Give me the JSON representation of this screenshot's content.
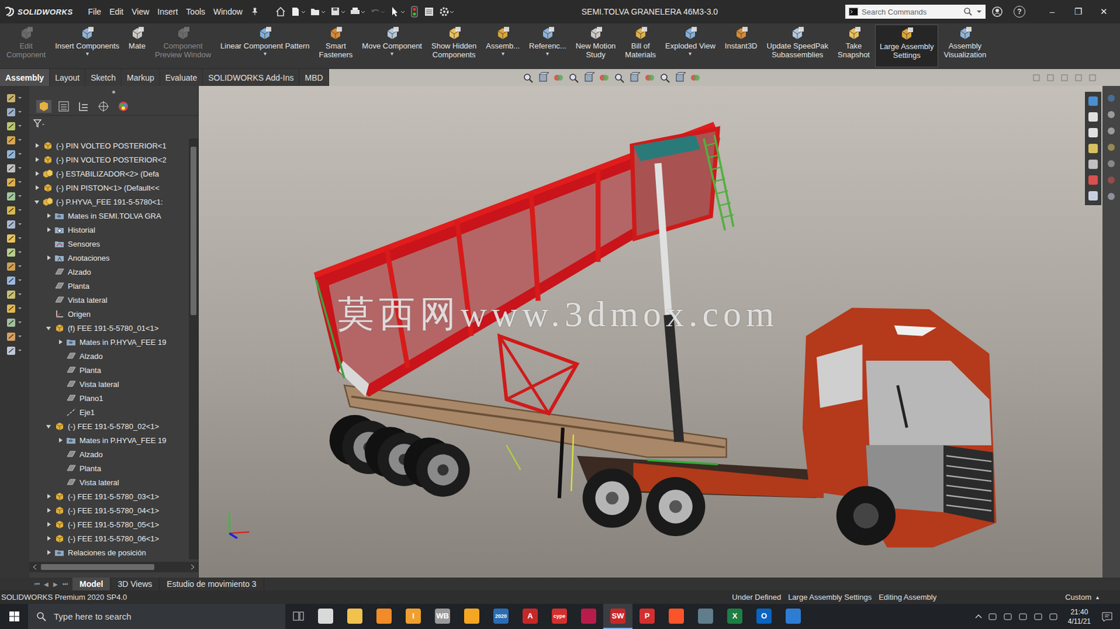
{
  "window": {
    "title": "SEMI.TOLVA GRANELERA 46M3-3.0",
    "controls": [
      "–",
      "❐",
      "✕"
    ],
    "help": "?"
  },
  "app": {
    "name": "SOLIDWORKS"
  },
  "menu": [
    "File",
    "Edit",
    "View",
    "Insert",
    "Tools",
    "Window"
  ],
  "search": {
    "placeholder": "Search Commands"
  },
  "ribbon": {
    "arrow": "▾",
    "buttons": [
      {
        "lines": [
          "Edit",
          "Component"
        ],
        "disabled": true,
        "selected": false,
        "dropdown": false
      },
      {
        "lines": [
          "Insert Components"
        ],
        "disabled": false,
        "selected": false,
        "dropdown": true
      },
      {
        "lines": [
          "Mate"
        ],
        "disabled": false,
        "selected": false,
        "dropdown": false
      },
      {
        "lines": [
          "Component",
          "Preview Window"
        ],
        "disabled": true,
        "selected": false,
        "dropdown": false
      },
      {
        "lines": [
          "Linear Component Pattern"
        ],
        "disabled": false,
        "selected": false,
        "dropdown": true
      },
      {
        "lines": [
          "Smart",
          "Fasteners"
        ],
        "disabled": false,
        "selected": false,
        "dropdown": false
      },
      {
        "lines": [
          "Move Component"
        ],
        "disabled": false,
        "selected": false,
        "dropdown": true
      },
      {
        "lines": [
          "Show Hidden",
          "Components"
        ],
        "disabled": false,
        "selected": false,
        "dropdown": false
      },
      {
        "lines": [
          "Assemb..."
        ],
        "disabled": false,
        "selected": false,
        "dropdown": true
      },
      {
        "lines": [
          "Referenc..."
        ],
        "disabled": false,
        "selected": false,
        "dropdown": true
      },
      {
        "lines": [
          "New Motion",
          "Study"
        ],
        "disabled": false,
        "selected": false,
        "dropdown": false
      },
      {
        "lines": [
          "Bill of",
          "Materials"
        ],
        "disabled": false,
        "selected": false,
        "dropdown": false
      },
      {
        "lines": [
          "Exploded View"
        ],
        "disabled": false,
        "selected": false,
        "dropdown": true
      },
      {
        "lines": [
          "Instant3D"
        ],
        "disabled": false,
        "selected": false,
        "dropdown": false
      },
      {
        "lines": [
          "Update SpeedPak",
          "Subassemblies"
        ],
        "disabled": false,
        "selected": false,
        "dropdown": false
      },
      {
        "lines": [
          "Take",
          "Snapshot"
        ],
        "disabled": false,
        "selected": false,
        "dropdown": false
      },
      {
        "lines": [
          "Large Assembly",
          "Settings"
        ],
        "disabled": false,
        "selected": true,
        "dropdown": false
      },
      {
        "lines": [
          "Assembly",
          "Visualization"
        ],
        "disabled": false,
        "selected": false,
        "dropdown": false
      }
    ]
  },
  "tabs": [
    {
      "label": "Assembly",
      "selected": true
    },
    {
      "label": "Layout",
      "selected": false
    },
    {
      "label": "Sketch",
      "selected": false
    },
    {
      "label": "Markup",
      "selected": false
    },
    {
      "label": "Evaluate",
      "selected": false
    },
    {
      "label": "SOLIDWORKS Add-Ins",
      "selected": false
    },
    {
      "label": "MBD",
      "selected": false
    }
  ],
  "tree": {
    "vscroll": {
      "offset": 0.02,
      "size": 0.4
    },
    "hscroll": {
      "offset": 0.0,
      "size": 0.78
    },
    "items": [
      {
        "label": "(-) PIN VOLTEO POSTERIOR<1",
        "depth": 0,
        "expandable": true,
        "expanded": false,
        "kind": "part"
      },
      {
        "label": "(-) PIN VOLTEO POSTERIOR<2",
        "depth": 0,
        "expandable": true,
        "expanded": false,
        "kind": "part"
      },
      {
        "label": "(-) ESTABILIZADOR<2> (Defa",
        "depth": 0,
        "expandable": true,
        "expanded": false,
        "kind": "assembly"
      },
      {
        "label": "(-) PIN PISTON<1> (Default<<",
        "depth": 0,
        "expandable": true,
        "expanded": false,
        "kind": "part"
      },
      {
        "label": "(-) P.HYVA_FEE 191-5-5780<1:",
        "depth": 0,
        "expandable": true,
        "expanded": true,
        "kind": "assembly"
      },
      {
        "label": "Mates in SEMI.TOLVA GRA",
        "depth": 1,
        "expandable": true,
        "expanded": false,
        "kind": "mates"
      },
      {
        "label": "Historial",
        "depth": 1,
        "expandable": true,
        "expanded": false,
        "kind": "history"
      },
      {
        "label": "Sensores",
        "depth": 1,
        "expandable": false,
        "expanded": false,
        "kind": "sensor"
      },
      {
        "label": "Anotaciones",
        "depth": 1,
        "expandable": true,
        "expanded": false,
        "kind": "annotation"
      },
      {
        "label": "Alzado",
        "depth": 1,
        "expandable": false,
        "expanded": false,
        "kind": "plane"
      },
      {
        "label": "Planta",
        "depth": 1,
        "expandable": false,
        "expanded": false,
        "kind": "plane"
      },
      {
        "label": "Vista lateral",
        "depth": 1,
        "expandable": false,
        "expanded": false,
        "kind": "plane"
      },
      {
        "label": "Origen",
        "depth": 1,
        "expandable": false,
        "expanded": false,
        "kind": "origin"
      },
      {
        "label": "(f) FEE 191-5-5780_01<1>",
        "depth": 1,
        "expandable": true,
        "expanded": true,
        "kind": "part"
      },
      {
        "label": "Mates in P.HYVA_FEE 19",
        "depth": 2,
        "expandable": true,
        "expanded": false,
        "kind": "mates"
      },
      {
        "label": "Alzado",
        "depth": 2,
        "expandable": false,
        "expanded": false,
        "kind": "plane"
      },
      {
        "label": "Planta",
        "depth": 2,
        "expandable": false,
        "expanded": false,
        "kind": "plane"
      },
      {
        "label": "Vista lateral",
        "depth": 2,
        "expandable": false,
        "expanded": false,
        "kind": "plane"
      },
      {
        "label": "Plano1",
        "depth": 2,
        "expandable": false,
        "expanded": false,
        "kind": "plane"
      },
      {
        "label": "Eje1",
        "depth": 2,
        "expandable": false,
        "expanded": false,
        "kind": "axis"
      },
      {
        "label": "(-) FEE 191-5-5780_02<1>",
        "depth": 1,
        "expandable": true,
        "expanded": true,
        "kind": "part"
      },
      {
        "label": "Mates in P.HYVA_FEE 19",
        "depth": 2,
        "expandable": true,
        "expanded": false,
        "kind": "mates"
      },
      {
        "label": "Alzado",
        "depth": 2,
        "expandable": false,
        "expanded": false,
        "kind": "plane"
      },
      {
        "label": "Planta",
        "depth": 2,
        "expandable": false,
        "expanded": false,
        "kind": "plane"
      },
      {
        "label": "Vista lateral",
        "depth": 2,
        "expandable": false,
        "expanded": false,
        "kind": "plane"
      },
      {
        "label": "(-) FEE 191-5-5780_03<1>",
        "depth": 1,
        "expandable": true,
        "expanded": false,
        "kind": "part"
      },
      {
        "label": "(-) FEE 191-5-5780_04<1>",
        "depth": 1,
        "expandable": true,
        "expanded": false,
        "kind": "part"
      },
      {
        "label": "(-) FEE 191-5-5780_05<1>",
        "depth": 1,
        "expandable": true,
        "expanded": false,
        "kind": "part"
      },
      {
        "label": "(-) FEE 191-5-5780_06<1>",
        "depth": 1,
        "expandable": true,
        "expanded": false,
        "kind": "part"
      },
      {
        "label": "Relaciones de posición",
        "depth": 1,
        "expandable": true,
        "expanded": false,
        "kind": "mates"
      }
    ]
  },
  "bottom_tabs": {
    "nav": [
      "⏮",
      "◀",
      "▶",
      "⏭"
    ],
    "items": [
      {
        "label": "Model",
        "selected": true
      },
      {
        "label": "3D Views",
        "selected": false
      },
      {
        "label": "Estudio de movimiento 3",
        "selected": false
      }
    ]
  },
  "watermark": "莫西网www.3dmox.com",
  "status_bar": {
    "product": "SOLIDWORKS Premium 2020 SP4.0",
    "fields": [
      "Under Defined",
      "Large Assembly Settings",
      "Editing Assembly"
    ],
    "units": "Custom",
    "arrow": "▴"
  },
  "taskbar": {
    "search_placeholder": "Type here to search",
    "time": "21:40",
    "date": "4/11/21",
    "apps": [
      {
        "color": "#d9d9d9",
        "active": false
      },
      {
        "color": "#f2c14e",
        "active": false
      },
      {
        "color": "#f28c28",
        "active": false
      },
      {
        "label": "I",
        "color": "#f0a030",
        "active": false
      },
      {
        "label": "WB",
        "color": "#9a9a9a",
        "active": false
      },
      {
        "color": "#f5a623",
        "active": false
      },
      {
        "label": "2020",
        "color": "#2a6db5",
        "active": false
      },
      {
        "label": "A",
        "color": "#c62828",
        "active": false
      },
      {
        "label": "cype",
        "color": "#d32f2f",
        "active": false
      },
      {
        "color": "#b71c4a",
        "active": false
      },
      {
        "label": "SW",
        "color": "#c62828",
        "active": true
      },
      {
        "label": "P",
        "color": "#d32f2f",
        "active": false
      },
      {
        "color": "#fb542b",
        "active": false
      },
      {
        "color": "#607d8b",
        "active": false
      },
      {
        "label": "X",
        "color": "#1e7e45",
        "active": false
      },
      {
        "label": "O",
        "color": "#0a64c2",
        "active": false
      },
      {
        "color": "#2d7dd2",
        "active": false
      }
    ]
  }
}
